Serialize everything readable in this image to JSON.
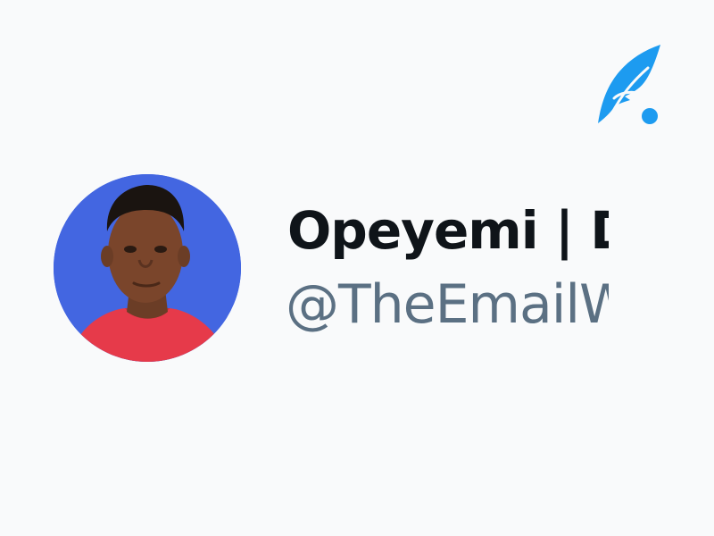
{
  "app": {
    "logo_icon": "feather-quill-logo-icon",
    "accent_color": "#1d9bf0"
  },
  "profile": {
    "avatar_icon": "profile-photo",
    "avatar_background": "#4366e1",
    "display_name": "Opeyemi | D",
    "handle": "@TheEmailW",
    "name_color": "#0f1419",
    "handle_color": "#5b7083"
  }
}
